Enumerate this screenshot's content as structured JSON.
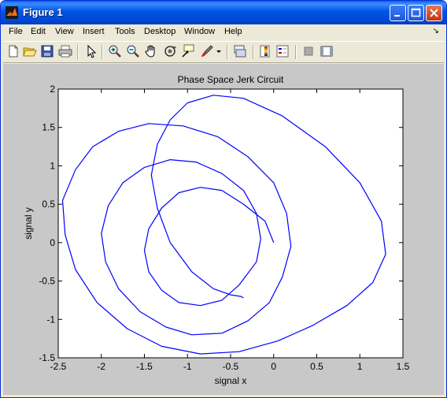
{
  "window": {
    "title": "Figure 1",
    "accent": "#0054e3",
    "frame_color": "#ece9d8",
    "figure_background": "#c8c8c8"
  },
  "menubar": {
    "items": [
      {
        "label": "File"
      },
      {
        "label": "Edit"
      },
      {
        "label": "View"
      },
      {
        "label": "Insert"
      },
      {
        "label": "Tools"
      },
      {
        "label": "Desktop"
      },
      {
        "label": "Window"
      },
      {
        "label": "Help"
      }
    ]
  },
  "toolbar": {
    "tools": [
      {
        "icon": "new-figure-icon"
      },
      {
        "icon": "open-file-icon"
      },
      {
        "icon": "save-icon"
      },
      {
        "icon": "print-icon"
      },
      {
        "icon": "arrow-pointer-icon"
      },
      {
        "icon": "zoom-in-icon"
      },
      {
        "icon": "zoom-out-icon"
      },
      {
        "icon": "pan-hand-icon"
      },
      {
        "icon": "rotate-3d-icon"
      },
      {
        "icon": "data-cursor-icon"
      },
      {
        "icon": "brush-icon"
      },
      {
        "icon": "link-plot-icon"
      },
      {
        "icon": "colorbar-icon"
      },
      {
        "icon": "legend-icon"
      },
      {
        "icon": "hide-plot-tools-icon"
      },
      {
        "icon": "show-plot-tools-icon"
      }
    ]
  },
  "chart_data": {
    "type": "line",
    "title": "Phase Space Jerk Circuit",
    "xlabel": "signal x",
    "ylabel": "signal y",
    "xlim": [
      -2.5,
      1.5
    ],
    "ylim": [
      -1.5,
      2
    ],
    "xticks": [
      "-2.5",
      "-2",
      "-1.5",
      "-1",
      "-0.5",
      "0",
      "0.5",
      "1",
      "1.5"
    ],
    "yticks": [
      "-1.5",
      "-1",
      "-0.5",
      "0",
      "0.5",
      "1",
      "1.5",
      "2"
    ],
    "grid": false,
    "line_color": "#0000ff",
    "series": [
      {
        "x": [
          0.0,
          -0.1,
          -0.35,
          -0.6,
          -0.85,
          -1.1,
          -1.3,
          -1.45,
          -1.5,
          -1.45,
          -1.3,
          -1.1,
          -0.85,
          -0.6,
          -0.4,
          -0.2,
          -0.15,
          -0.2,
          -0.35,
          -0.6,
          -0.9,
          -1.2,
          -1.5,
          -1.75,
          -1.92,
          -2.0,
          -1.95,
          -1.8,
          -1.55,
          -1.25,
          -0.95,
          -0.6,
          -0.3,
          -0.05,
          0.1,
          0.2,
          0.15,
          0.0,
          -0.3,
          -0.65,
          -1.05,
          -1.45,
          -1.8,
          -2.1,
          -2.3,
          -2.45,
          -2.42,
          -2.3,
          -2.05,
          -1.7,
          -1.3,
          -0.85,
          -0.4,
          0.05,
          0.45,
          0.85,
          1.15,
          1.3,
          1.25,
          1.0,
          0.6,
          0.1,
          -0.35,
          -0.7,
          -1.0,
          -1.2,
          -1.35,
          -1.42,
          -1.35,
          -1.2,
          -0.95,
          -0.7,
          -0.5,
          -0.38,
          -0.35
        ],
        "y": [
          0.0,
          0.28,
          0.5,
          0.68,
          0.72,
          0.65,
          0.45,
          0.18,
          -0.1,
          -0.38,
          -0.62,
          -0.78,
          -0.82,
          -0.75,
          -0.55,
          -0.25,
          0.05,
          0.38,
          0.68,
          0.9,
          1.05,
          1.08,
          0.98,
          0.78,
          0.48,
          0.12,
          -0.25,
          -0.6,
          -0.9,
          -1.1,
          -1.2,
          -1.18,
          -1.02,
          -0.78,
          -0.45,
          -0.05,
          0.38,
          0.78,
          1.12,
          1.38,
          1.52,
          1.55,
          1.45,
          1.25,
          0.95,
          0.55,
          0.1,
          -0.35,
          -0.78,
          -1.12,
          -1.35,
          -1.45,
          -1.42,
          -1.28,
          -1.08,
          -0.82,
          -0.52,
          -0.15,
          0.28,
          0.78,
          1.25,
          1.65,
          1.88,
          1.92,
          1.82,
          1.6,
          1.28,
          0.88,
          0.45,
          0.0,
          -0.38,
          -0.6,
          -0.68,
          -0.7,
          -0.72
        ]
      }
    ]
  }
}
